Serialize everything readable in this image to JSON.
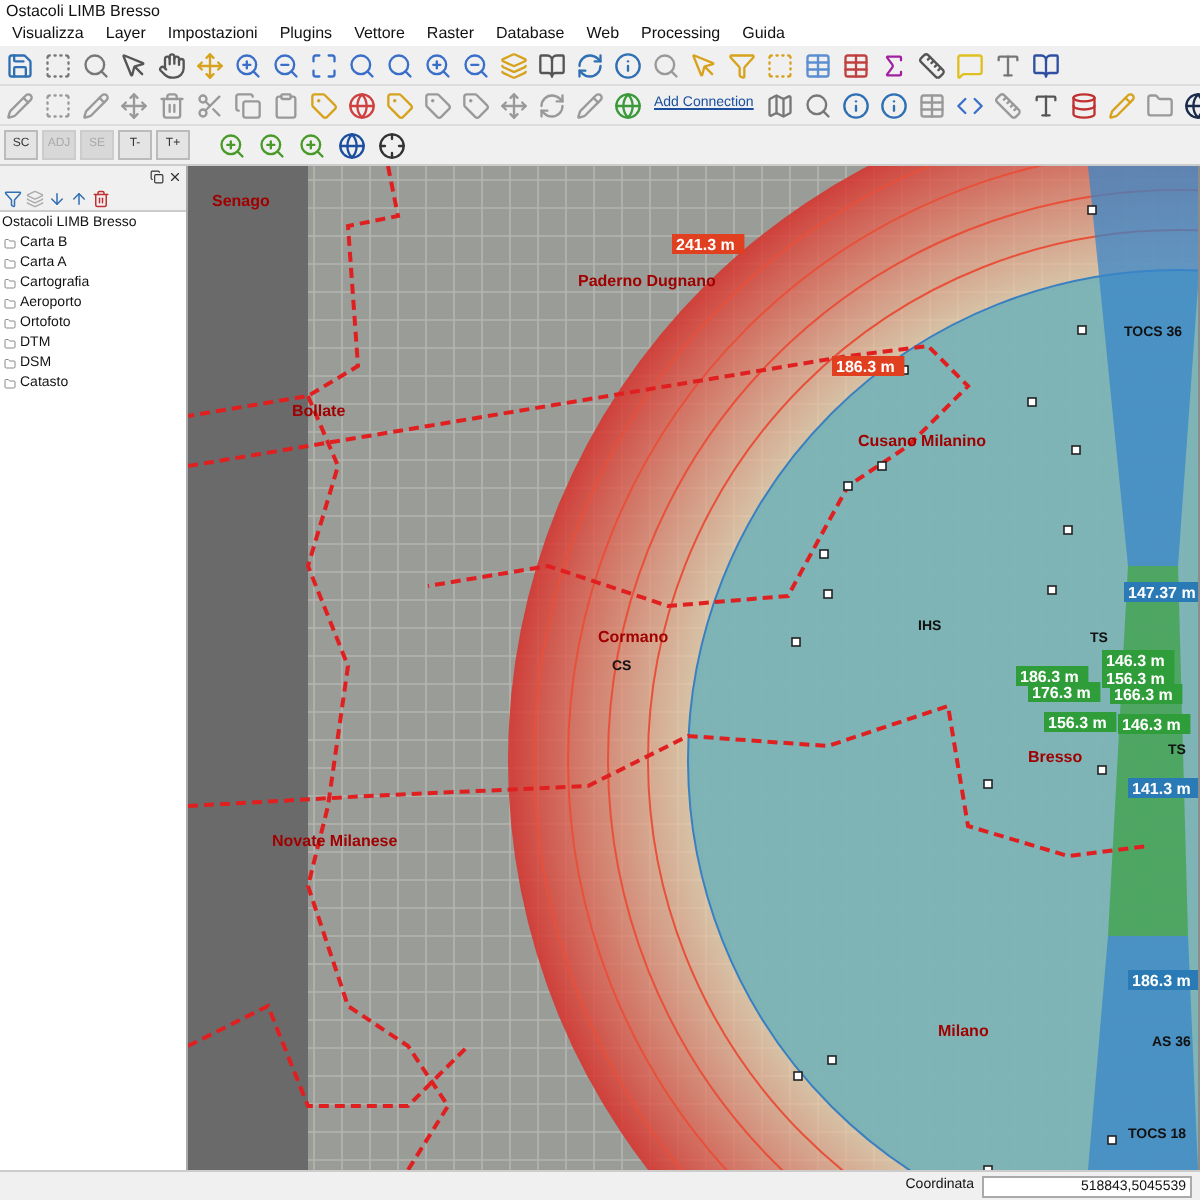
{
  "window": {
    "title": "Ostacoli LIMB Bresso"
  },
  "menu": [
    "Visualizza",
    "Layer",
    "Impostazioni",
    "Plugins",
    "Vettore",
    "Raster",
    "Database",
    "Web",
    "Processing",
    "Guida"
  ],
  "toolbar": {
    "add_connection": "Add Connection",
    "label_buttons": [
      {
        "label": "SC",
        "disabled": false
      },
      {
        "label": "ADJ",
        "disabled": true
      },
      {
        "label": "SE",
        "disabled": true
      },
      {
        "label": "T-",
        "disabled": false
      },
      {
        "label": "T+",
        "disabled": false
      }
    ]
  },
  "layers_panel": {
    "root": {
      "label": "Ostacoli LIMB Bresso",
      "children": [
        {
          "label": "Carta B"
        },
        {
          "label": "Carta A"
        },
        {
          "label": "Cartografia"
        },
        {
          "label": "Aeroporto"
        },
        {
          "label": "Ortofoto"
        },
        {
          "label": "DTM"
        },
        {
          "label": "DSM"
        },
        {
          "label": "Catasto"
        }
      ]
    }
  },
  "map": {
    "place_names": [
      "Senago",
      "Bollate",
      "Paderno Dugnano",
      "Cusano Milanino",
      "Cormano",
      "Novate Milanese",
      "Bresso",
      "Milano"
    ],
    "distance_labels": [
      {
        "text": "241.3 m",
        "color": "#e0401f"
      },
      {
        "text": "186.3 m",
        "color": "#e0401f"
      },
      {
        "text": "147.37 m",
        "color": "#2a7bb5"
      },
      {
        "text": "146.3 m",
        "color": "#2f9e3a"
      },
      {
        "text": "186.3 m",
        "color": "#2f9e3a"
      },
      {
        "text": "156.3 m",
        "color": "#2f9e3a"
      },
      {
        "text": "176.3 m",
        "color": "#2f9e3a"
      },
      {
        "text": "166.3 m",
        "color": "#2f9e3a"
      },
      {
        "text": "156.3 m",
        "color": "#2f9e3a"
      },
      {
        "text": "146.3 m",
        "color": "#2f9e3a"
      },
      {
        "text": "141.3 m",
        "color": "#2a7bb5"
      },
      {
        "text": "186.3 m",
        "color": "#2a7bb5"
      }
    ],
    "surface_labels": [
      "TOCS 36",
      "TS",
      "TS",
      "IHS",
      "CS",
      "AS 36",
      "TOCS 18"
    ]
  },
  "status_bar": {
    "coordinate_label": "Coordinata",
    "coordinate_value": "518843,5045539"
  }
}
